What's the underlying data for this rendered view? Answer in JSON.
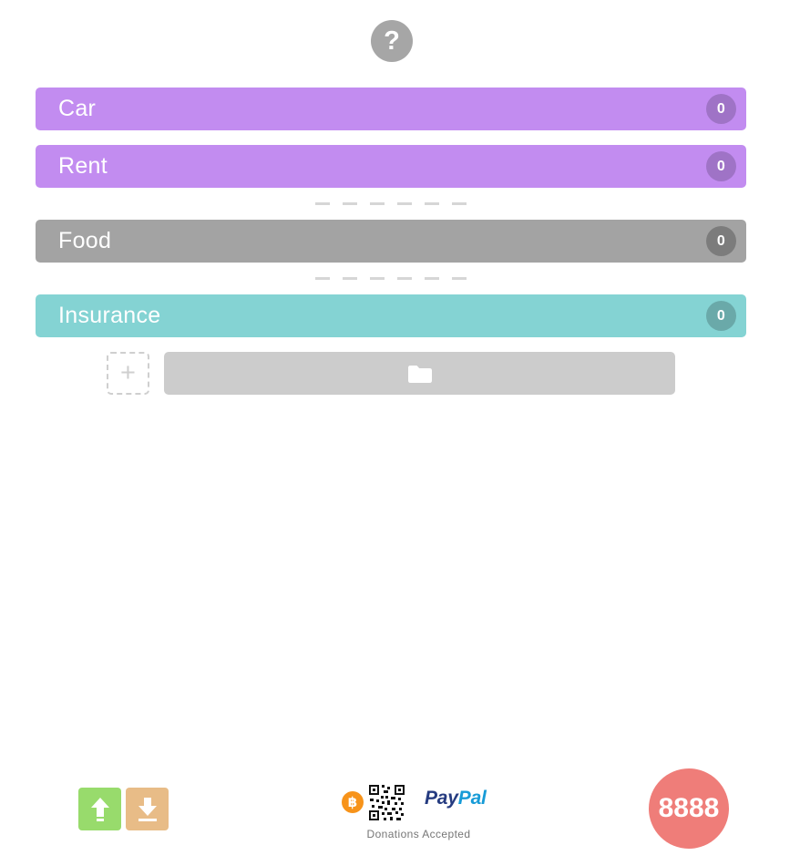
{
  "help": {
    "label": "?",
    "icon": "question-mark-icon"
  },
  "categories": [
    {
      "label": "Car",
      "count": "0",
      "color": "#c28cf0",
      "badge_color": "#9f73c6"
    },
    {
      "label": "Rent",
      "count": "0",
      "color": "#c28cf0",
      "badge_color": "#9f73c6"
    },
    {
      "label": "Food",
      "count": "0",
      "color": "#a3a3a3",
      "badge_color": "#7c7c7c"
    },
    {
      "label": "Insurance",
      "count": "0",
      "color": "#84d3d3",
      "badge_color": "#6aa9a9"
    }
  ],
  "actions": {
    "add_label": "+",
    "add_icon": "plus-icon",
    "folder_icon": "folder-icon"
  },
  "footer": {
    "upload_icon": "upload-icon",
    "download_icon": "download-icon",
    "bitcoin_label": "฿",
    "bitcoin_icon": "bitcoin-icon",
    "qr_icon": "qr-code-icon",
    "paypal_pay": "Pay",
    "paypal_pal": "Pal",
    "donations_label": "Donations Accepted",
    "total_value": "8888",
    "colors": {
      "upload": "#98db6c",
      "download": "#e8bc87",
      "total": "#ef7d79",
      "paypal_dark": "#253b80",
      "paypal_light": "#179bd7"
    }
  }
}
